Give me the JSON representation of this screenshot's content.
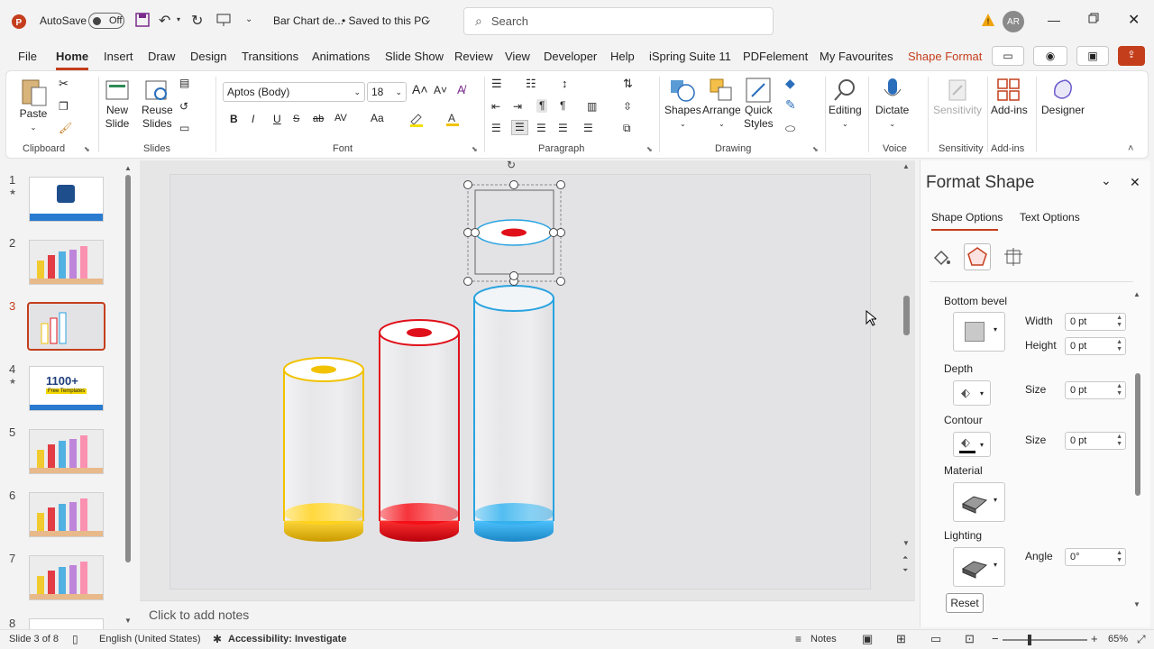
{
  "titlebar": {
    "autosave_label": "AutoSave",
    "autosave_state": "Off",
    "doc_title": "Bar Chart de...",
    "save_status": "• Saved to this PC",
    "search_placeholder": "Search",
    "avatar_initials": "AR"
  },
  "menu": {
    "tabs": [
      "File",
      "Home",
      "Insert",
      "Draw",
      "Design",
      "Transitions",
      "Animations",
      "Slide Show",
      "Review",
      "View",
      "Developer",
      "Help",
      "iSpring Suite 11",
      "PDFelement",
      "My Favourites",
      "Shape Format"
    ],
    "active": "Home"
  },
  "ribbon": {
    "clipboard": {
      "paste": "Paste",
      "label": "Clipboard"
    },
    "slides": {
      "new_slide_1": "New",
      "new_slide_2": "Slide",
      "reuse_1": "Reuse",
      "reuse_2": "Slides",
      "label": "Slides"
    },
    "font": {
      "name": "Aptos (Body)",
      "size": "18",
      "bold": "B",
      "italic": "I",
      "underline": "U",
      "strike": "ab",
      "spacing": "AV",
      "case": "Aa",
      "label": "Font"
    },
    "paragraph": {
      "label": "Paragraph"
    },
    "drawing": {
      "shapes": "Shapes",
      "arrange": "Arrange",
      "quick_1": "Quick",
      "quick_2": "Styles",
      "label": "Drawing"
    },
    "editing": {
      "label_btn": "Editing"
    },
    "voice": {
      "dictate": "Dictate",
      "label": "Voice"
    },
    "sensitivity": {
      "btn": "Sensitivity",
      "label": "Sensitivity"
    },
    "addins": {
      "btn": "Add-ins",
      "label": "Add-ins"
    },
    "designer": {
      "btn": "Designer"
    }
  },
  "slides_panel": {
    "numbers": [
      "1",
      "2",
      "3",
      "4",
      "5",
      "6",
      "7",
      "8"
    ],
    "selected": "3",
    "thumb4_text": "1100+",
    "thumb4_sub": "Free Templates"
  },
  "notes_placeholder": "Click to add notes",
  "format_pane": {
    "title": "Format Shape",
    "tab_shape": "Shape Options",
    "tab_text": "Text Options",
    "bottom_bevel": "Bottom bevel",
    "width_label": "Width",
    "width_value": "0 pt",
    "height_label": "Height",
    "height_value": "0 pt",
    "depth": "Depth",
    "depth_size_label": "Size",
    "depth_size": "0 pt",
    "contour": "Contour",
    "contour_size_label": "Size",
    "contour_size": "0 pt",
    "material": "Material",
    "lighting": "Lighting",
    "angle_label": "Angle",
    "angle_value": "0°",
    "reset": "Reset"
  },
  "status": {
    "slide_count": "Slide 3 of 8",
    "language": "English (United States)",
    "accessibility": "Accessibility: Investigate",
    "notes": "Notes",
    "zoom": "65%"
  },
  "colors": {
    "accent": "#c43e1c",
    "yellow": "#f2c200",
    "red": "#e0101a",
    "blue": "#29a3e0"
  }
}
